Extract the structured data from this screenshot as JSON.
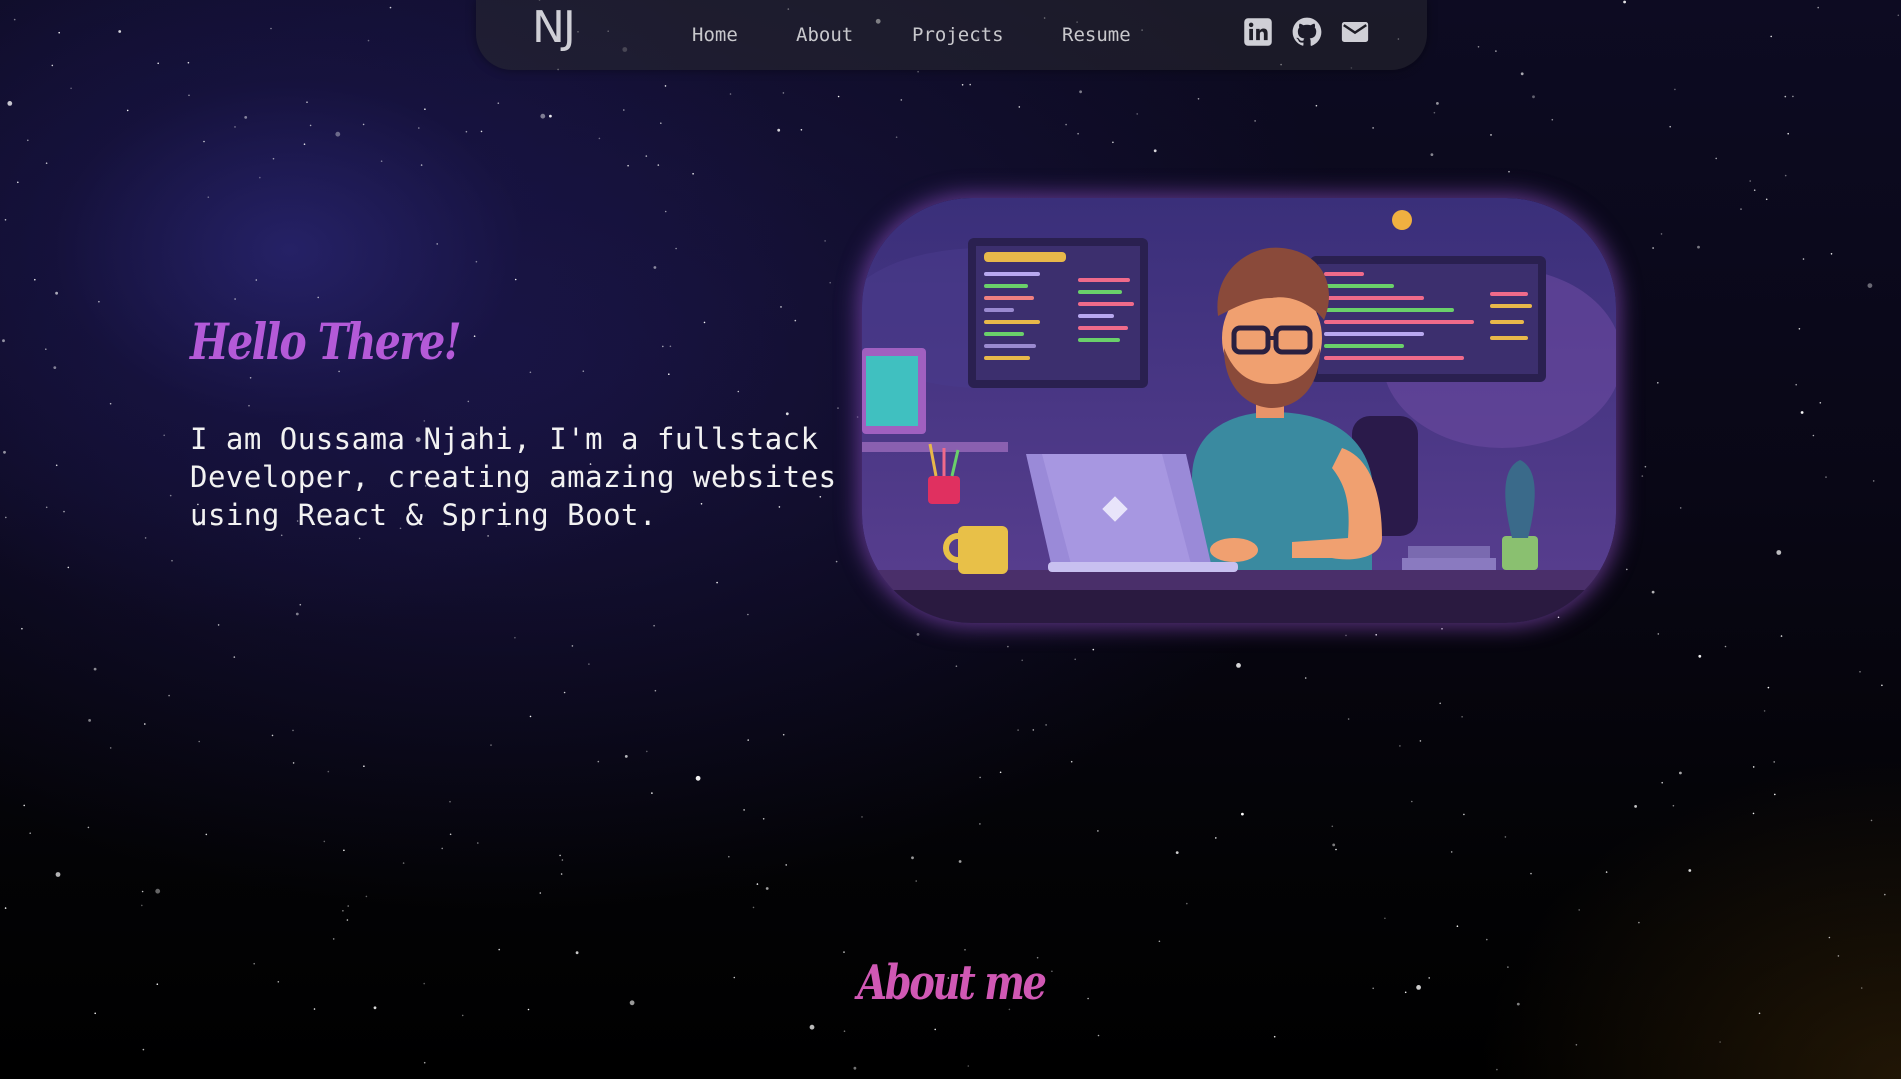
{
  "navbar": {
    "logo": "NJ",
    "links": [
      {
        "label": "Home"
      },
      {
        "label": "About"
      },
      {
        "label": "Projects"
      },
      {
        "label": "Resume"
      }
    ],
    "social_icons": [
      "linkedin-icon",
      "github-icon",
      "email-icon"
    ]
  },
  "hero": {
    "greeting": "Hello There!",
    "intro": "I am Oussama Njahi, I'm a fullstack Developer, creating amazing websites using React & Spring Boot.",
    "illustration": "developer-at-desk-illustration"
  },
  "about": {
    "title": "About me"
  },
  "colors": {
    "greeting": "#b45ad8",
    "about_title": "#d058b4",
    "background": "#0b0a1c",
    "glow": "#a05adc"
  }
}
